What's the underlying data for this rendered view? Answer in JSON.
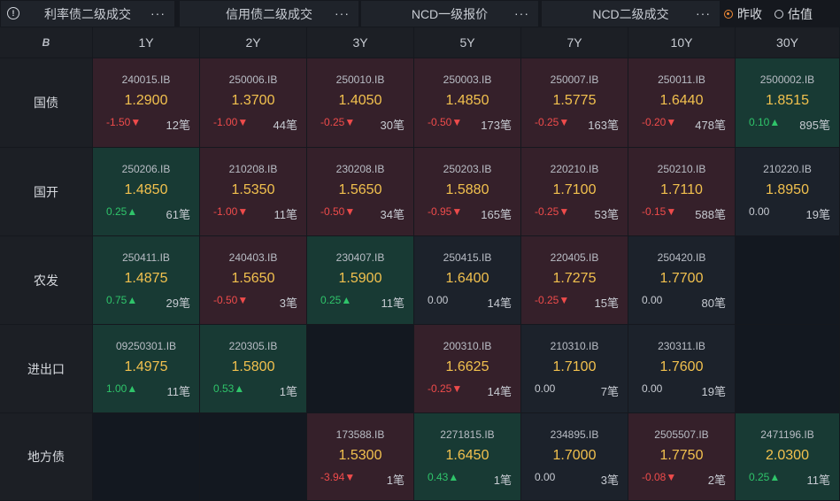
{
  "tabs": [
    {
      "label": "利率债二级成交",
      "active": true
    },
    {
      "label": "信用债二级成交",
      "active": false
    },
    {
      "label": "NCD一级报价",
      "active": false
    },
    {
      "label": "NCD二级成交",
      "active": false
    }
  ],
  "more_glyph": "···",
  "info_glyph": "!",
  "radios": [
    {
      "label": "昨收",
      "checked": true
    },
    {
      "label": "估值",
      "checked": false
    }
  ],
  "corner_icon": "B",
  "tenors": [
    "1Y",
    "2Y",
    "3Y",
    "5Y",
    "7Y",
    "10Y",
    "30Y"
  ],
  "rows": [
    {
      "label": "国债",
      "cells": [
        {
          "code": "240015.IB",
          "yield": "1.2900",
          "change": "-1.50▼",
          "count": "12笔",
          "tone": "red",
          "dir": "up"
        },
        {
          "code": "250006.IB",
          "yield": "1.3700",
          "change": "-1.00▼",
          "count": "44笔",
          "tone": "red",
          "dir": "up"
        },
        {
          "code": "250010.IB",
          "yield": "1.4050",
          "change": "-0.25▼",
          "count": "30笔",
          "tone": "red",
          "dir": "up"
        },
        {
          "code": "250003.IB",
          "yield": "1.4850",
          "change": "-0.50▼",
          "count": "173笔",
          "tone": "red",
          "dir": "up"
        },
        {
          "code": "250007.IB",
          "yield": "1.5775",
          "change": "-0.25▼",
          "count": "163笔",
          "tone": "red",
          "dir": "up"
        },
        {
          "code": "250011.IB",
          "yield": "1.6440",
          "change": "-0.20▼",
          "count": "478笔",
          "tone": "red",
          "dir": "up"
        },
        {
          "code": "2500002.IB",
          "yield": "1.8515",
          "change": "0.10▲",
          "count": "895笔",
          "tone": "green",
          "dir": "down"
        }
      ]
    },
    {
      "label": "国开",
      "cells": [
        {
          "code": "250206.IB",
          "yield": "1.4850",
          "change": "0.25▲",
          "count": "61笔",
          "tone": "green",
          "dir": "down"
        },
        {
          "code": "210208.IB",
          "yield": "1.5350",
          "change": "-1.00▼",
          "count": "11笔",
          "tone": "red",
          "dir": "up"
        },
        {
          "code": "230208.IB",
          "yield": "1.5650",
          "change": "-0.50▼",
          "count": "34笔",
          "tone": "red",
          "dir": "up"
        },
        {
          "code": "250203.IB",
          "yield": "1.5880",
          "change": "-0.95▼",
          "count": "165笔",
          "tone": "red",
          "dir": "up"
        },
        {
          "code": "220210.IB",
          "yield": "1.7100",
          "change": "-0.25▼",
          "count": "53笔",
          "tone": "red",
          "dir": "up"
        },
        {
          "code": "250210.IB",
          "yield": "1.7110",
          "change": "-0.15▼",
          "count": "588笔",
          "tone": "red",
          "dir": "up"
        },
        {
          "code": "210220.IB",
          "yield": "1.8950",
          "change": "0.00",
          "count": "19笔",
          "tone": "neutral",
          "dir": "flat"
        }
      ]
    },
    {
      "label": "农发",
      "cells": [
        {
          "code": "250411.IB",
          "yield": "1.4875",
          "change": "0.75▲",
          "count": "29笔",
          "tone": "green",
          "dir": "down"
        },
        {
          "code": "240403.IB",
          "yield": "1.5650",
          "change": "-0.50▼",
          "count": "3笔",
          "tone": "red",
          "dir": "up"
        },
        {
          "code": "230407.IB",
          "yield": "1.5900",
          "change": "0.25▲",
          "count": "11笔",
          "tone": "green",
          "dir": "down"
        },
        {
          "code": "250415.IB",
          "yield": "1.6400",
          "change": "0.00",
          "count": "14笔",
          "tone": "neutral",
          "dir": "flat"
        },
        {
          "code": "220405.IB",
          "yield": "1.7275",
          "change": "-0.25▼",
          "count": "15笔",
          "tone": "red",
          "dir": "up"
        },
        {
          "code": "250420.IB",
          "yield": "1.7700",
          "change": "0.00",
          "count": "80笔",
          "tone": "neutral",
          "dir": "flat"
        },
        null
      ]
    },
    {
      "label": "进出口",
      "cells": [
        {
          "code": "09250301.IB",
          "yield": "1.4975",
          "change": "1.00▲",
          "count": "11笔",
          "tone": "green",
          "dir": "down"
        },
        {
          "code": "220305.IB",
          "yield": "1.5800",
          "change": "0.53▲",
          "count": "1笔",
          "tone": "green",
          "dir": "down"
        },
        null,
        {
          "code": "200310.IB",
          "yield": "1.6625",
          "change": "-0.25▼",
          "count": "14笔",
          "tone": "red",
          "dir": "up"
        },
        {
          "code": "210310.IB",
          "yield": "1.7100",
          "change": "0.00",
          "count": "7笔",
          "tone": "neutral",
          "dir": "flat"
        },
        {
          "code": "230311.IB",
          "yield": "1.7600",
          "change": "0.00",
          "count": "19笔",
          "tone": "neutral",
          "dir": "flat"
        },
        null
      ]
    },
    {
      "label": "地方债",
      "cells": [
        null,
        null,
        {
          "code": "173588.IB",
          "yield": "1.5300",
          "change": "-3.94▼",
          "count": "1笔",
          "tone": "red",
          "dir": "up"
        },
        {
          "code": "2271815.IB",
          "yield": "1.6450",
          "change": "0.43▲",
          "count": "1笔",
          "tone": "green",
          "dir": "down"
        },
        {
          "code": "234895.IB",
          "yield": "1.7000",
          "change": "0.00",
          "count": "3笔",
          "tone": "neutral",
          "dir": "flat"
        },
        {
          "code": "2505507.IB",
          "yield": "1.7750",
          "change": "-0.08▼",
          "count": "2笔",
          "tone": "red",
          "dir": "up"
        },
        {
          "code": "2471196.IB",
          "yield": "2.0300",
          "change": "0.25▲",
          "count": "11笔",
          "tone": "green",
          "dir": "down"
        }
      ]
    }
  ]
}
